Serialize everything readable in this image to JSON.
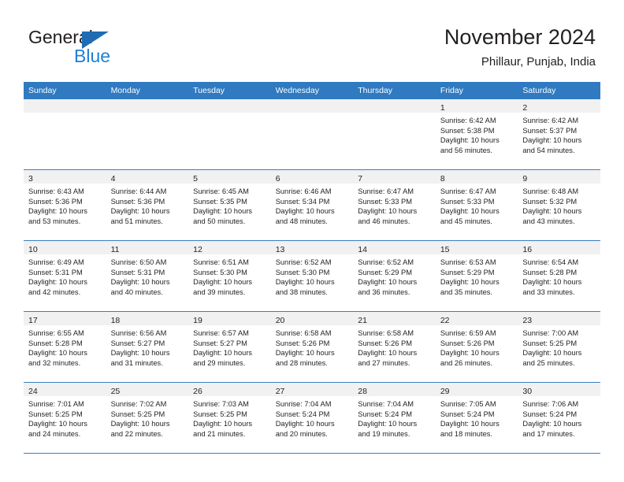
{
  "brand": {
    "name_part1": "General",
    "name_part2": "Blue",
    "color_dark": "#231f20",
    "color_blue": "#1f7fd4",
    "triangle_color": "#1f6cb4"
  },
  "header": {
    "title": "November 2024",
    "subtitle": "Phillaur, Punjab, India"
  },
  "theme": {
    "header_bg": "#2f7ac0",
    "daynum_bg": "#f1f1f1",
    "grid_line": "#3a7fbf",
    "text": "#231f20"
  },
  "weekday_headers": [
    "Sunday",
    "Monday",
    "Tuesday",
    "Wednesday",
    "Thursday",
    "Friday",
    "Saturday"
  ],
  "weeks": [
    [
      {
        "empty": true
      },
      {
        "empty": true
      },
      {
        "empty": true
      },
      {
        "empty": true
      },
      {
        "empty": true
      },
      {
        "empty": false,
        "day": "1",
        "sunrise": "Sunrise: 6:42 AM",
        "sunset": "Sunset: 5:38 PM",
        "daylight1": "Daylight: 10 hours",
        "daylight2": "and 56 minutes."
      },
      {
        "empty": false,
        "day": "2",
        "sunrise": "Sunrise: 6:42 AM",
        "sunset": "Sunset: 5:37 PM",
        "daylight1": "Daylight: 10 hours",
        "daylight2": "and 54 minutes."
      }
    ],
    [
      {
        "empty": false,
        "day": "3",
        "sunrise": "Sunrise: 6:43 AM",
        "sunset": "Sunset: 5:36 PM",
        "daylight1": "Daylight: 10 hours",
        "daylight2": "and 53 minutes."
      },
      {
        "empty": false,
        "day": "4",
        "sunrise": "Sunrise: 6:44 AM",
        "sunset": "Sunset: 5:36 PM",
        "daylight1": "Daylight: 10 hours",
        "daylight2": "and 51 minutes."
      },
      {
        "empty": false,
        "day": "5",
        "sunrise": "Sunrise: 6:45 AM",
        "sunset": "Sunset: 5:35 PM",
        "daylight1": "Daylight: 10 hours",
        "daylight2": "and 50 minutes."
      },
      {
        "empty": false,
        "day": "6",
        "sunrise": "Sunrise: 6:46 AM",
        "sunset": "Sunset: 5:34 PM",
        "daylight1": "Daylight: 10 hours",
        "daylight2": "and 48 minutes."
      },
      {
        "empty": false,
        "day": "7",
        "sunrise": "Sunrise: 6:47 AM",
        "sunset": "Sunset: 5:33 PM",
        "daylight1": "Daylight: 10 hours",
        "daylight2": "and 46 minutes."
      },
      {
        "empty": false,
        "day": "8",
        "sunrise": "Sunrise: 6:47 AM",
        "sunset": "Sunset: 5:33 PM",
        "daylight1": "Daylight: 10 hours",
        "daylight2": "and 45 minutes."
      },
      {
        "empty": false,
        "day": "9",
        "sunrise": "Sunrise: 6:48 AM",
        "sunset": "Sunset: 5:32 PM",
        "daylight1": "Daylight: 10 hours",
        "daylight2": "and 43 minutes."
      }
    ],
    [
      {
        "empty": false,
        "day": "10",
        "sunrise": "Sunrise: 6:49 AM",
        "sunset": "Sunset: 5:31 PM",
        "daylight1": "Daylight: 10 hours",
        "daylight2": "and 42 minutes."
      },
      {
        "empty": false,
        "day": "11",
        "sunrise": "Sunrise: 6:50 AM",
        "sunset": "Sunset: 5:31 PM",
        "daylight1": "Daylight: 10 hours",
        "daylight2": "and 40 minutes."
      },
      {
        "empty": false,
        "day": "12",
        "sunrise": "Sunrise: 6:51 AM",
        "sunset": "Sunset: 5:30 PM",
        "daylight1": "Daylight: 10 hours",
        "daylight2": "and 39 minutes."
      },
      {
        "empty": false,
        "day": "13",
        "sunrise": "Sunrise: 6:52 AM",
        "sunset": "Sunset: 5:30 PM",
        "daylight1": "Daylight: 10 hours",
        "daylight2": "and 38 minutes."
      },
      {
        "empty": false,
        "day": "14",
        "sunrise": "Sunrise: 6:52 AM",
        "sunset": "Sunset: 5:29 PM",
        "daylight1": "Daylight: 10 hours",
        "daylight2": "and 36 minutes."
      },
      {
        "empty": false,
        "day": "15",
        "sunrise": "Sunrise: 6:53 AM",
        "sunset": "Sunset: 5:29 PM",
        "daylight1": "Daylight: 10 hours",
        "daylight2": "and 35 minutes."
      },
      {
        "empty": false,
        "day": "16",
        "sunrise": "Sunrise: 6:54 AM",
        "sunset": "Sunset: 5:28 PM",
        "daylight1": "Daylight: 10 hours",
        "daylight2": "and 33 minutes."
      }
    ],
    [
      {
        "empty": false,
        "day": "17",
        "sunrise": "Sunrise: 6:55 AM",
        "sunset": "Sunset: 5:28 PM",
        "daylight1": "Daylight: 10 hours",
        "daylight2": "and 32 minutes."
      },
      {
        "empty": false,
        "day": "18",
        "sunrise": "Sunrise: 6:56 AM",
        "sunset": "Sunset: 5:27 PM",
        "daylight1": "Daylight: 10 hours",
        "daylight2": "and 31 minutes."
      },
      {
        "empty": false,
        "day": "19",
        "sunrise": "Sunrise: 6:57 AM",
        "sunset": "Sunset: 5:27 PM",
        "daylight1": "Daylight: 10 hours",
        "daylight2": "and 29 minutes."
      },
      {
        "empty": false,
        "day": "20",
        "sunrise": "Sunrise: 6:58 AM",
        "sunset": "Sunset: 5:26 PM",
        "daylight1": "Daylight: 10 hours",
        "daylight2": "and 28 minutes."
      },
      {
        "empty": false,
        "day": "21",
        "sunrise": "Sunrise: 6:58 AM",
        "sunset": "Sunset: 5:26 PM",
        "daylight1": "Daylight: 10 hours",
        "daylight2": "and 27 minutes."
      },
      {
        "empty": false,
        "day": "22",
        "sunrise": "Sunrise: 6:59 AM",
        "sunset": "Sunset: 5:26 PM",
        "daylight1": "Daylight: 10 hours",
        "daylight2": "and 26 minutes."
      },
      {
        "empty": false,
        "day": "23",
        "sunrise": "Sunrise: 7:00 AM",
        "sunset": "Sunset: 5:25 PM",
        "daylight1": "Daylight: 10 hours",
        "daylight2": "and 25 minutes."
      }
    ],
    [
      {
        "empty": false,
        "day": "24",
        "sunrise": "Sunrise: 7:01 AM",
        "sunset": "Sunset: 5:25 PM",
        "daylight1": "Daylight: 10 hours",
        "daylight2": "and 24 minutes."
      },
      {
        "empty": false,
        "day": "25",
        "sunrise": "Sunrise: 7:02 AM",
        "sunset": "Sunset: 5:25 PM",
        "daylight1": "Daylight: 10 hours",
        "daylight2": "and 22 minutes."
      },
      {
        "empty": false,
        "day": "26",
        "sunrise": "Sunrise: 7:03 AM",
        "sunset": "Sunset: 5:25 PM",
        "daylight1": "Daylight: 10 hours",
        "daylight2": "and 21 minutes."
      },
      {
        "empty": false,
        "day": "27",
        "sunrise": "Sunrise: 7:04 AM",
        "sunset": "Sunset: 5:24 PM",
        "daylight1": "Daylight: 10 hours",
        "daylight2": "and 20 minutes."
      },
      {
        "empty": false,
        "day": "28",
        "sunrise": "Sunrise: 7:04 AM",
        "sunset": "Sunset: 5:24 PM",
        "daylight1": "Daylight: 10 hours",
        "daylight2": "and 19 minutes."
      },
      {
        "empty": false,
        "day": "29",
        "sunrise": "Sunrise: 7:05 AM",
        "sunset": "Sunset: 5:24 PM",
        "daylight1": "Daylight: 10 hours",
        "daylight2": "and 18 minutes."
      },
      {
        "empty": false,
        "day": "30",
        "sunrise": "Sunrise: 7:06 AM",
        "sunset": "Sunset: 5:24 PM",
        "daylight1": "Daylight: 10 hours",
        "daylight2": "and 17 minutes."
      }
    ]
  ]
}
